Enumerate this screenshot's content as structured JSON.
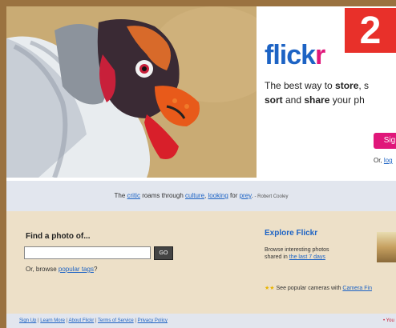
{
  "logo": {
    "main": "flick",
    "accent": "r"
  },
  "badge": "2",
  "tagline": {
    "line1_pre": "The best way to ",
    "line1_bold": "store",
    "line1_post": ", s",
    "line2_bold1": "sort",
    "line2_mid": " and ",
    "line2_bold2": "share",
    "line2_post": " your ph"
  },
  "signup_button": "Sig",
  "or_login": {
    "prefix": "Or, ",
    "link": "log"
  },
  "quote": {
    "pre": "The ",
    "link1": "critic",
    "mid1": " roams through ",
    "link2": "culture",
    "sep": ", ",
    "link3": "looking",
    "mid2": " for ",
    "link4": "prey",
    "post": ".",
    "attribution": " - Robert Cooley"
  },
  "find": {
    "title": "Find a photo of...",
    "input_value": "",
    "go_label": "GO",
    "browse_prefix": "Or, browse ",
    "browse_link": "popular tags",
    "browse_suffix": "?"
  },
  "explore": {
    "title": "Explore Flickr",
    "line1": "Browse interesting photos",
    "line2_prefix": "shared in ",
    "line2_link": "the last 7 days",
    "camera_star": "★★",
    "camera_text": " See popular cameras with ",
    "camera_link": "Camera Fin"
  },
  "footer": {
    "links": [
      "Sign Up",
      "Learn More",
      "About Flickr",
      "Terms of Service",
      "Privacy Policy"
    ],
    "right": "• You"
  }
}
